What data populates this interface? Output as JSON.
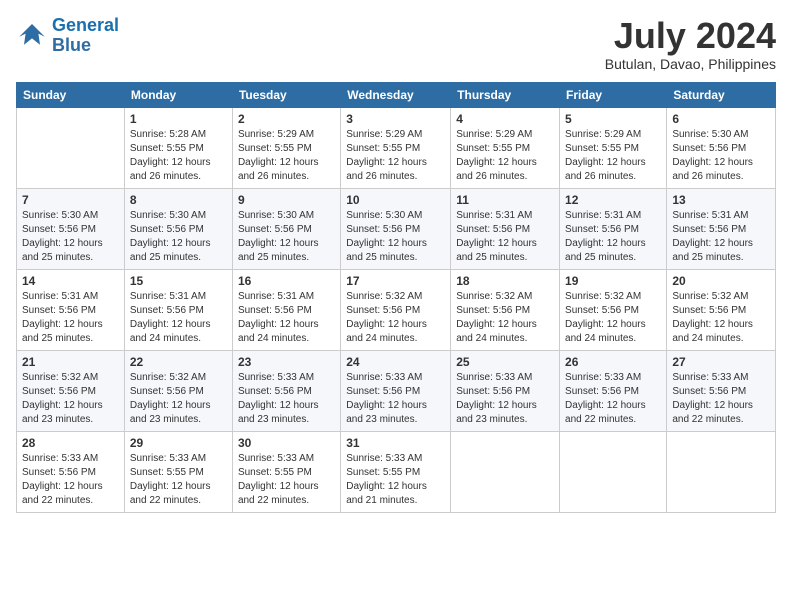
{
  "header": {
    "logo_line1": "General",
    "logo_line2": "Blue",
    "month_year": "July 2024",
    "location": "Butulan, Davao, Philippines"
  },
  "days_of_week": [
    "Sunday",
    "Monday",
    "Tuesday",
    "Wednesday",
    "Thursday",
    "Friday",
    "Saturday"
  ],
  "weeks": [
    [
      {
        "day": "",
        "info": ""
      },
      {
        "day": "1",
        "info": "Sunrise: 5:28 AM\nSunset: 5:55 PM\nDaylight: 12 hours\nand 26 minutes."
      },
      {
        "day": "2",
        "info": "Sunrise: 5:29 AM\nSunset: 5:55 PM\nDaylight: 12 hours\nand 26 minutes."
      },
      {
        "day": "3",
        "info": "Sunrise: 5:29 AM\nSunset: 5:55 PM\nDaylight: 12 hours\nand 26 minutes."
      },
      {
        "day": "4",
        "info": "Sunrise: 5:29 AM\nSunset: 5:55 PM\nDaylight: 12 hours\nand 26 minutes."
      },
      {
        "day": "5",
        "info": "Sunrise: 5:29 AM\nSunset: 5:55 PM\nDaylight: 12 hours\nand 26 minutes."
      },
      {
        "day": "6",
        "info": "Sunrise: 5:30 AM\nSunset: 5:56 PM\nDaylight: 12 hours\nand 26 minutes."
      }
    ],
    [
      {
        "day": "7",
        "info": "Sunrise: 5:30 AM\nSunset: 5:56 PM\nDaylight: 12 hours\nand 25 minutes."
      },
      {
        "day": "8",
        "info": "Sunrise: 5:30 AM\nSunset: 5:56 PM\nDaylight: 12 hours\nand 25 minutes."
      },
      {
        "day": "9",
        "info": "Sunrise: 5:30 AM\nSunset: 5:56 PM\nDaylight: 12 hours\nand 25 minutes."
      },
      {
        "day": "10",
        "info": "Sunrise: 5:30 AM\nSunset: 5:56 PM\nDaylight: 12 hours\nand 25 minutes."
      },
      {
        "day": "11",
        "info": "Sunrise: 5:31 AM\nSunset: 5:56 PM\nDaylight: 12 hours\nand 25 minutes."
      },
      {
        "day": "12",
        "info": "Sunrise: 5:31 AM\nSunset: 5:56 PM\nDaylight: 12 hours\nand 25 minutes."
      },
      {
        "day": "13",
        "info": "Sunrise: 5:31 AM\nSunset: 5:56 PM\nDaylight: 12 hours\nand 25 minutes."
      }
    ],
    [
      {
        "day": "14",
        "info": "Sunrise: 5:31 AM\nSunset: 5:56 PM\nDaylight: 12 hours\nand 25 minutes."
      },
      {
        "day": "15",
        "info": "Sunrise: 5:31 AM\nSunset: 5:56 PM\nDaylight: 12 hours\nand 24 minutes."
      },
      {
        "day": "16",
        "info": "Sunrise: 5:31 AM\nSunset: 5:56 PM\nDaylight: 12 hours\nand 24 minutes."
      },
      {
        "day": "17",
        "info": "Sunrise: 5:32 AM\nSunset: 5:56 PM\nDaylight: 12 hours\nand 24 minutes."
      },
      {
        "day": "18",
        "info": "Sunrise: 5:32 AM\nSunset: 5:56 PM\nDaylight: 12 hours\nand 24 minutes."
      },
      {
        "day": "19",
        "info": "Sunrise: 5:32 AM\nSunset: 5:56 PM\nDaylight: 12 hours\nand 24 minutes."
      },
      {
        "day": "20",
        "info": "Sunrise: 5:32 AM\nSunset: 5:56 PM\nDaylight: 12 hours\nand 24 minutes."
      }
    ],
    [
      {
        "day": "21",
        "info": "Sunrise: 5:32 AM\nSunset: 5:56 PM\nDaylight: 12 hours\nand 23 minutes."
      },
      {
        "day": "22",
        "info": "Sunrise: 5:32 AM\nSunset: 5:56 PM\nDaylight: 12 hours\nand 23 minutes."
      },
      {
        "day": "23",
        "info": "Sunrise: 5:33 AM\nSunset: 5:56 PM\nDaylight: 12 hours\nand 23 minutes."
      },
      {
        "day": "24",
        "info": "Sunrise: 5:33 AM\nSunset: 5:56 PM\nDaylight: 12 hours\nand 23 minutes."
      },
      {
        "day": "25",
        "info": "Sunrise: 5:33 AM\nSunset: 5:56 PM\nDaylight: 12 hours\nand 23 minutes."
      },
      {
        "day": "26",
        "info": "Sunrise: 5:33 AM\nSunset: 5:56 PM\nDaylight: 12 hours\nand 22 minutes."
      },
      {
        "day": "27",
        "info": "Sunrise: 5:33 AM\nSunset: 5:56 PM\nDaylight: 12 hours\nand 22 minutes."
      }
    ],
    [
      {
        "day": "28",
        "info": "Sunrise: 5:33 AM\nSunset: 5:56 PM\nDaylight: 12 hours\nand 22 minutes."
      },
      {
        "day": "29",
        "info": "Sunrise: 5:33 AM\nSunset: 5:55 PM\nDaylight: 12 hours\nand 22 minutes."
      },
      {
        "day": "30",
        "info": "Sunrise: 5:33 AM\nSunset: 5:55 PM\nDaylight: 12 hours\nand 22 minutes."
      },
      {
        "day": "31",
        "info": "Sunrise: 5:33 AM\nSunset: 5:55 PM\nDaylight: 12 hours\nand 21 minutes."
      },
      {
        "day": "",
        "info": ""
      },
      {
        "day": "",
        "info": ""
      },
      {
        "day": "",
        "info": ""
      }
    ]
  ]
}
